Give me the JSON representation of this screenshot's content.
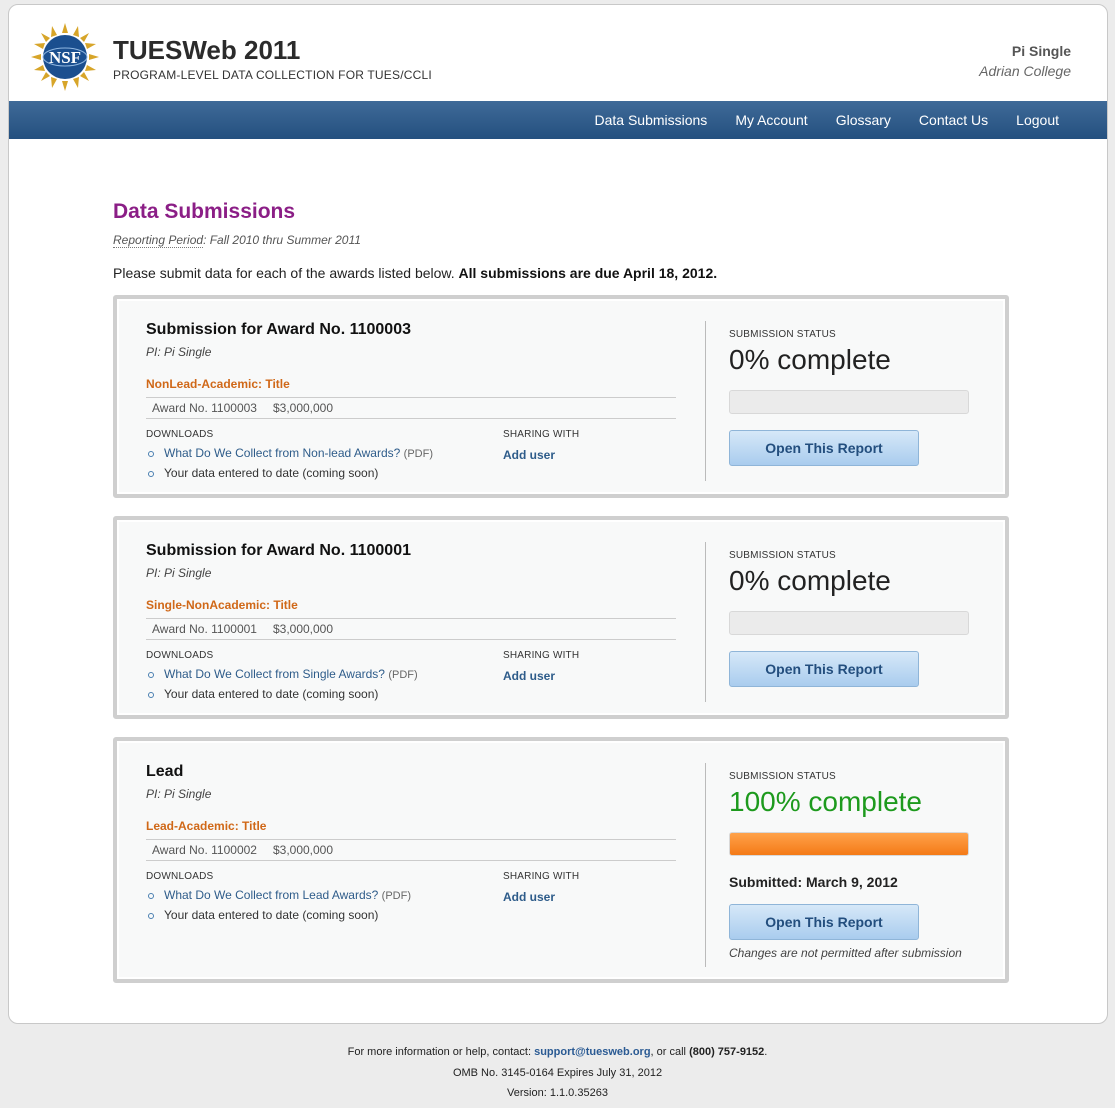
{
  "header": {
    "logo_text": "NSF",
    "title": "TUESWeb 2011",
    "subtitle": "PROGRAM-LEVEL DATA COLLECTION FOR TUES/CCLI",
    "user_name": "Pi Single",
    "user_org": "Adrian College"
  },
  "nav": {
    "items": [
      "Data Submissions",
      "My Account",
      "Glossary",
      "Contact Us",
      "Logout"
    ]
  },
  "page": {
    "title": "Data Submissions",
    "period_label": "Reporting Period",
    "period_value": ": Fall 2010 thru Summer 2011",
    "intro_text": "Please submit data for each of the awards listed below.",
    "intro_bold": "All submissions are due April 18, 2012."
  },
  "labels": {
    "downloads": "DOWNLOADS",
    "sharing_with": "SHARING WITH",
    "add_user": "Add user",
    "submission_status": "SUBMISSION STATUS",
    "open_report": "Open This Report",
    "pdf": "(PDF)",
    "data_to_date": "Your data entered to date (coming soon)"
  },
  "submissions": [
    {
      "title": "Submission for Award No. 1100003",
      "pi": "PI: Pi Single",
      "type": "NonLead-Academic: Title",
      "award_no": "Award No. 1100003",
      "amount": "$3,000,000",
      "download_link": "What Do We Collect from Non-lead Awards?",
      "status": "0% complete",
      "progress": 0,
      "submitted": "",
      "note": ""
    },
    {
      "title": "Submission for Award No. 1100001",
      "pi": "PI: Pi Single",
      "type": "Single-NonAcademic: Title",
      "award_no": "Award No. 1100001",
      "amount": "$3,000,000",
      "download_link": "What Do We Collect from Single Awards?",
      "status": "0% complete",
      "progress": 0,
      "submitted": "",
      "note": ""
    },
    {
      "title": "Lead",
      "pi": "PI: Pi Single",
      "type": "Lead-Academic: Title",
      "award_no": "Award No. 1100002",
      "amount": "$3,000,000",
      "download_link": "What Do We Collect from Lead Awards?",
      "status": "100% complete",
      "progress": 100,
      "submitted": "Submitted: March 9, 2012",
      "note": "Changes are not permitted after submission"
    }
  ],
  "footer": {
    "help_prefix": "For more information or help, contact: ",
    "email": "support@tuesweb.org",
    "help_mid": ", or call ",
    "phone": "(800) 757-9152",
    "help_suffix": ".",
    "omb": "OMB No. 3145-0164 Expires July 31, 2012",
    "version": "Version: 1.1.0.35263"
  },
  "colors": {
    "accent_purple": "#8b1e86",
    "award_type_orange": "#d06818",
    "nav_blue": "#24507f",
    "complete_green": "#1d9a1d",
    "progress_orange": "#f47a17"
  }
}
